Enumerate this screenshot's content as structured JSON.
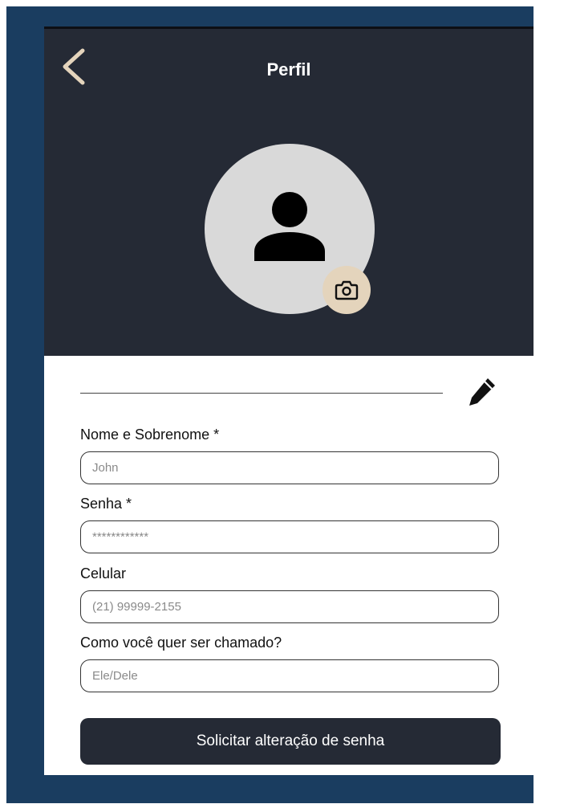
{
  "header": {
    "title": "Perfil",
    "back_icon": "chevron-left-icon",
    "camera_icon": "camera-icon"
  },
  "profile": {
    "edit_icon": "pencil-icon"
  },
  "form": {
    "name_label": "Nome e Sobrenome *",
    "name_placeholder": "John",
    "password_label": "Senha *",
    "password_placeholder": "************",
    "phone_label": "Celular",
    "phone_placeholder": "(21) 99999-2155",
    "nickname_label": "Como você quer ser chamado?",
    "nickname_placeholder": "Ele/Dele"
  },
  "actions": {
    "request_password_change": "Solicitar alteração de senha"
  },
  "colors": {
    "frame": "#1a3d60",
    "header": "#252a35",
    "accent": "#e4d4bc",
    "avatar_bg": "#d9d9d9"
  }
}
